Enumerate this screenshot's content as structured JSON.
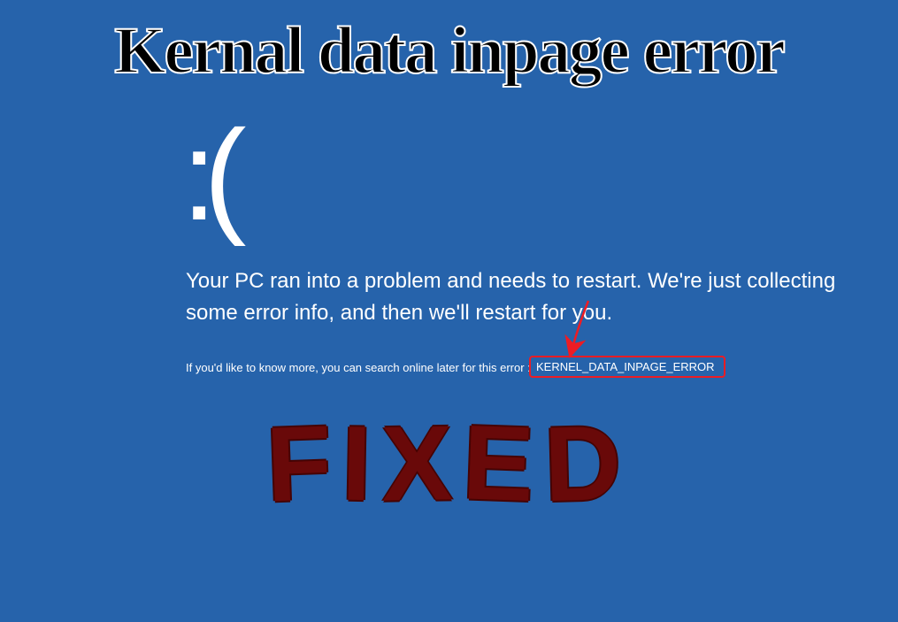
{
  "overlay": {
    "title": "Kernal data inpage error",
    "fixed_label": "FIXED"
  },
  "bsod": {
    "sad_face": ":(",
    "main_message": "Your PC ran into a problem and needs to restart. We're just collecting some error info, and then we'll restart for you.",
    "detail_prefix": "If you'd like to know more, you can search online later for this error :",
    "error_code": "KERNEL_DATA_INPAGE_ERROR"
  },
  "colors": {
    "background": "#2663ab",
    "highlight": "#ed1c24",
    "fixed_text": "#6b1414"
  }
}
